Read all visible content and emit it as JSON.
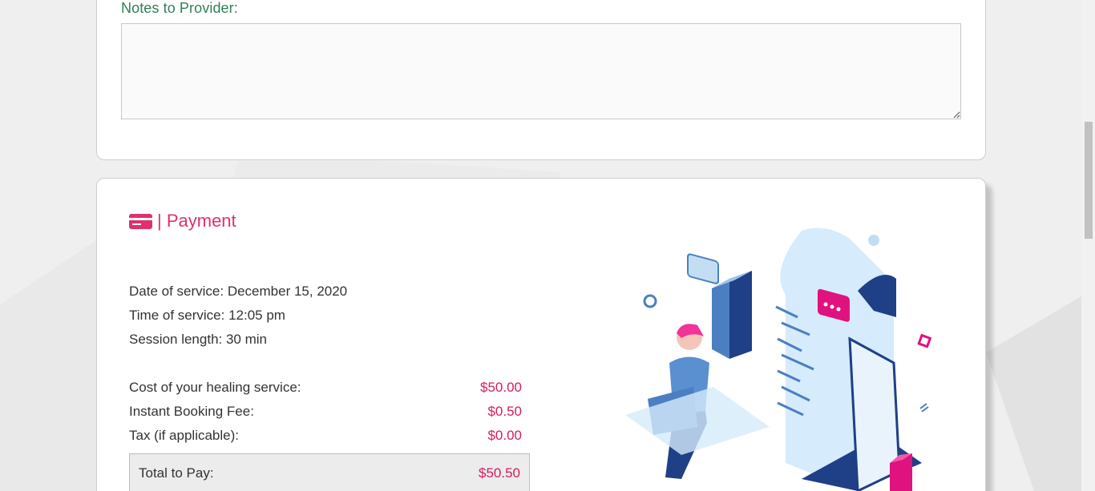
{
  "notes": {
    "label": "Notes to Provider:",
    "value": "",
    "placeholder": ""
  },
  "payment": {
    "title": "| Payment",
    "icon": "credit-card-icon",
    "date_of_service": "Date of service: December 15, 2020",
    "time_of_service": "Time of service: 12:05 pm",
    "session_length": "Session length: 30 min",
    "line_items": [
      {
        "label": "Cost of your healing service:",
        "amount": "$50.00"
      },
      {
        "label": "Instant Booking Fee:",
        "amount": "$0.50"
      },
      {
        "label": "Tax (if applicable):",
        "amount": "$0.00"
      }
    ],
    "total": {
      "label": "Total to Pay:",
      "amount": "$50.50"
    }
  },
  "colors": {
    "accent_pink": "#d81b60",
    "label_green": "#2f7f57",
    "illustration_blue": "#1f3f86",
    "illustration_light": "#d6ebfb"
  }
}
